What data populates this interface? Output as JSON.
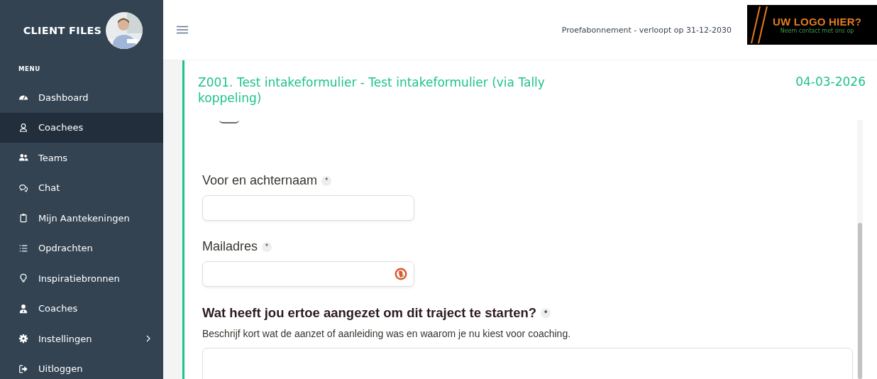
{
  "brand": {
    "title": "CLIENT FILES"
  },
  "sidebar": {
    "heading": "MENU",
    "items": [
      {
        "label": "Dashboard",
        "selected": false,
        "has_submenu": false
      },
      {
        "label": "Coachees",
        "selected": true,
        "has_submenu": false
      },
      {
        "label": "Teams",
        "selected": false,
        "has_submenu": false
      },
      {
        "label": "Chat",
        "selected": false,
        "has_submenu": false
      },
      {
        "label": "Mijn Aantekeningen",
        "selected": false,
        "has_submenu": false
      },
      {
        "label": "Opdrachten",
        "selected": false,
        "has_submenu": false
      },
      {
        "label": "Inspiratiebronnen",
        "selected": false,
        "has_submenu": false
      },
      {
        "label": "Coaches",
        "selected": false,
        "has_submenu": false
      },
      {
        "label": "Instellingen",
        "selected": false,
        "has_submenu": true
      },
      {
        "label": "Uitloggen",
        "selected": false,
        "has_submenu": false
      }
    ]
  },
  "topbar": {
    "subscription": "Proefabonnement - verloopt op 31-12-2030",
    "logo": {
      "title": "UW LOGO HIER?",
      "subtitle": "Neem contact met ons op"
    }
  },
  "card": {
    "title": "Z001. Test intakeformulier - Test intakeformulier (via Tally koppeling)",
    "date": "04-03-2026",
    "form": [
      {
        "kind": "text",
        "label": "Voor en achternaam",
        "required_mark": "*"
      },
      {
        "kind": "email",
        "label": "Mailadres",
        "required_mark": "*"
      },
      {
        "kind": "textarea",
        "label": "Wat heeft jou ertoe aangezet om dit traject te starten?",
        "required_mark": "*",
        "description": "Beschrijf kort wat de aanzet of aanleiding was en waarom je nu kiest voor coaching."
      }
    ]
  }
}
